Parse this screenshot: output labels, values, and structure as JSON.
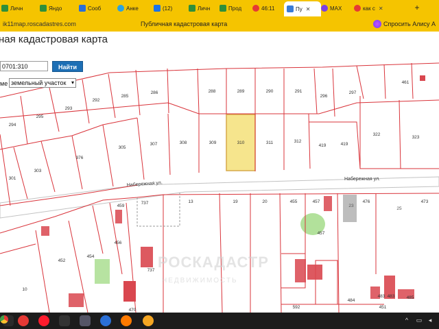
{
  "browser": {
    "tabs": [
      {
        "label": "Личн",
        "icon": "green-doc-icon",
        "color": "#2f8f3a"
      },
      {
        "label": "Яндо",
        "icon": "green-doc-icon",
        "color": "#2f8f3a"
      },
      {
        "label": "Сооб",
        "icon": "vk-icon",
        "color": "#2a6fd6"
      },
      {
        "label": "Анке",
        "icon": "telegram-icon",
        "color": "#2aa3e0"
      },
      {
        "label": "(12) ",
        "icon": "mail-icon",
        "color": "#1a73e8"
      },
      {
        "label": "Личн",
        "icon": "green-doc-icon",
        "color": "#2f8f3a"
      },
      {
        "label": "Прод",
        "icon": "green-doc-icon",
        "color": "#2f8f3a"
      },
      {
        "label": "46:11",
        "icon": "yandex-icon",
        "color": "#e53935"
      },
      {
        "label": "Пу",
        "icon": "map-icon",
        "color": "#3a7bd5",
        "active": true
      },
      {
        "label": "MAX",
        "icon": "max-icon",
        "color": "#7b3fe4"
      },
      {
        "label": "как с",
        "icon": "yandex-icon",
        "color": "#e53935"
      }
    ],
    "url": "ik11map.roscadastres.com",
    "page_title": "Публичная кадастровая карта",
    "alice_label": "Спросить Алису А"
  },
  "page": {
    "heading": "ная кадастровая карта",
    "search_value": "0701:310",
    "find_button": "Найти",
    "type_label": "ме",
    "type_selected": "земельный участок"
  },
  "map": {
    "streets": [
      "Набережная ул.",
      "Набережная ул."
    ],
    "watermark": "РОСКАДАСТР",
    "watermark_sub": "НЕДВИЖИМОСТЬ",
    "highlight_color": "#f6e58d",
    "parcel_labels": [
      "294",
      "295",
      "293",
      "292",
      "285",
      "286",
      "288",
      "289",
      "290",
      "291",
      "296",
      "297",
      "461",
      "301",
      "303",
      "976",
      "305",
      "307",
      "308",
      "309",
      "310",
      "311",
      "312",
      "419",
      "419",
      "322",
      "323",
      "737",
      "13",
      "19",
      "20",
      "455",
      "457",
      "476",
      "473",
      "23",
      "25",
      "459",
      "452",
      "454",
      "470",
      "456",
      "457",
      "10",
      "737",
      "484",
      "592",
      "483",
      "483",
      "485",
      "451"
    ]
  },
  "taskbar": {
    "icons": [
      "windows-start-icon",
      "chrome-icon",
      "yandex-browser-icon",
      "opera-icon",
      "epic-icon",
      "app-icon",
      "yandex-icon",
      "firefox-icon",
      "orange-app-icon"
    ]
  }
}
